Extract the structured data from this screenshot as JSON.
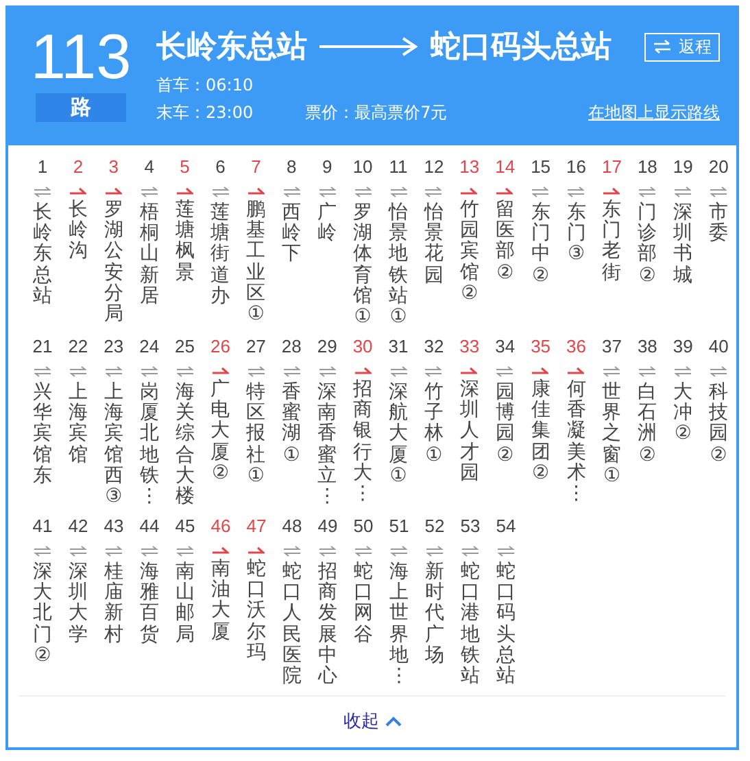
{
  "route": {
    "number": "113",
    "suffix": "路",
    "origin": "长岭东总站",
    "destination": "蛇口码头总站",
    "return_button": "返程",
    "first_bus": "首车：06:10",
    "last_bus": "末车：23:00",
    "fare": "票价：最高票价7元",
    "map_link": "在地图上显示路线"
  },
  "stops": [
    {
      "num": "1",
      "name": "长岭东总站",
      "kind": "two_way"
    },
    {
      "num": "2",
      "name": "长岭沟",
      "kind": "one_way"
    },
    {
      "num": "3",
      "name": "罗湖公安分局",
      "kind": "one_way"
    },
    {
      "num": "4",
      "name": "梧桐山新居",
      "kind": "two_way"
    },
    {
      "num": "5",
      "name": "莲塘枫景",
      "kind": "one_way"
    },
    {
      "num": "6",
      "name": "莲塘街道办",
      "kind": "two_way"
    },
    {
      "num": "7",
      "name": "鹏基工业区①",
      "kind": "one_way"
    },
    {
      "num": "8",
      "name": "西岭下",
      "kind": "two_way"
    },
    {
      "num": "9",
      "name": "广岭",
      "kind": "two_way"
    },
    {
      "num": "10",
      "name": "罗湖体育馆①",
      "kind": "two_way"
    },
    {
      "num": "11",
      "name": "怡景地铁站①",
      "kind": "two_way"
    },
    {
      "num": "12",
      "name": "怡景花园",
      "kind": "two_way"
    },
    {
      "num": "13",
      "name": "竹园宾馆②",
      "kind": "one_way"
    },
    {
      "num": "14",
      "name": "留医部②",
      "kind": "one_way"
    },
    {
      "num": "15",
      "name": "东门中②",
      "kind": "two_way"
    },
    {
      "num": "16",
      "name": "东门③",
      "kind": "two_way"
    },
    {
      "num": "17",
      "name": "东门老街",
      "kind": "one_way"
    },
    {
      "num": "18",
      "name": "门诊部②",
      "kind": "two_way"
    },
    {
      "num": "19",
      "name": "深圳书城",
      "kind": "two_way"
    },
    {
      "num": "20",
      "name": "市委",
      "kind": "two_way"
    },
    {
      "num": "21",
      "name": "兴华宾馆东",
      "kind": "two_way"
    },
    {
      "num": "22",
      "name": "上海宾馆",
      "kind": "two_way"
    },
    {
      "num": "23",
      "name": "上海宾馆西③",
      "kind": "two_way"
    },
    {
      "num": "24",
      "name": "岗厦北地铁⋮",
      "kind": "two_way"
    },
    {
      "num": "25",
      "name": "海关综合大楼",
      "kind": "two_way"
    },
    {
      "num": "26",
      "name": "广电大厦②",
      "kind": "one_way"
    },
    {
      "num": "27",
      "name": "特区报社①",
      "kind": "two_way"
    },
    {
      "num": "28",
      "name": "香蜜湖①",
      "kind": "two_way"
    },
    {
      "num": "29",
      "name": "深南香蜜立⋮",
      "kind": "two_way"
    },
    {
      "num": "30",
      "name": "招商银行大⋮",
      "kind": "one_way"
    },
    {
      "num": "31",
      "name": "深航大厦①",
      "kind": "two_way"
    },
    {
      "num": "32",
      "name": "竹子林①",
      "kind": "two_way"
    },
    {
      "num": "33",
      "name": "深圳人才园",
      "kind": "one_way"
    },
    {
      "num": "34",
      "name": "园博园②",
      "kind": "two_way"
    },
    {
      "num": "35",
      "name": "康佳集团②",
      "kind": "one_way"
    },
    {
      "num": "36",
      "name": "何香凝美术⋮",
      "kind": "one_way"
    },
    {
      "num": "37",
      "name": "世界之窗①",
      "kind": "two_way"
    },
    {
      "num": "38",
      "name": "白石洲②",
      "kind": "two_way"
    },
    {
      "num": "39",
      "name": "大冲②",
      "kind": "two_way"
    },
    {
      "num": "40",
      "name": "科技园②",
      "kind": "two_way"
    },
    {
      "num": "41",
      "name": "深大北门②",
      "kind": "two_way"
    },
    {
      "num": "42",
      "name": "深圳大学",
      "kind": "two_way"
    },
    {
      "num": "43",
      "name": "桂庙新村",
      "kind": "two_way"
    },
    {
      "num": "44",
      "name": "海雅百货",
      "kind": "two_way"
    },
    {
      "num": "45",
      "name": "南山邮局",
      "kind": "two_way"
    },
    {
      "num": "46",
      "name": "南油大厦",
      "kind": "one_way"
    },
    {
      "num": "47",
      "name": "蛇口沃尔玛",
      "kind": "one_way"
    },
    {
      "num": "48",
      "name": "蛇口人民医院",
      "kind": "two_way"
    },
    {
      "num": "49",
      "name": "招商发展中心",
      "kind": "two_way"
    },
    {
      "num": "50",
      "name": "蛇口网谷",
      "kind": "two_way"
    },
    {
      "num": "51",
      "name": "海上世界地⋮",
      "kind": "two_way"
    },
    {
      "num": "52",
      "name": "新时代广场",
      "kind": "two_way"
    },
    {
      "num": "53",
      "name": "蛇口港地铁站",
      "kind": "two_way"
    },
    {
      "num": "54",
      "name": "蛇口码头总站",
      "kind": "two_way"
    }
  ],
  "collapse_link": "收起"
}
